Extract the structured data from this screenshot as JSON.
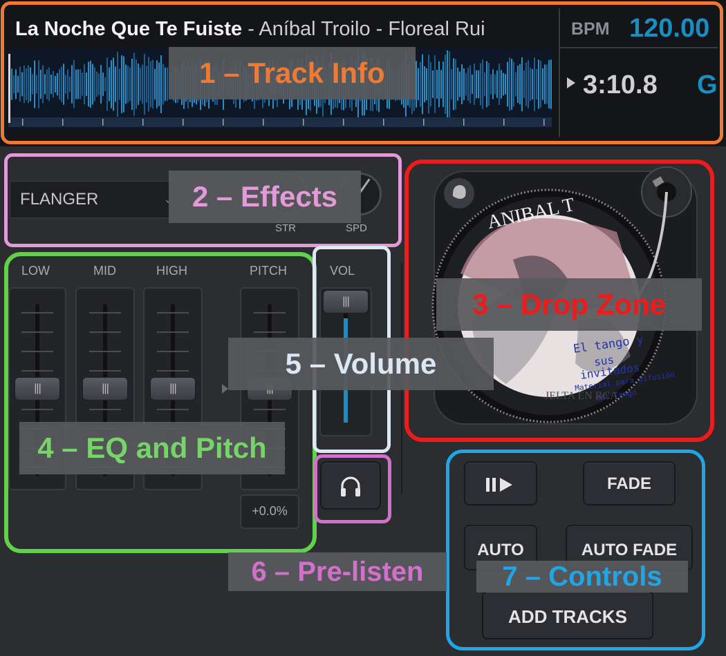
{
  "track": {
    "title": "La Noche Que Te Fuiste",
    "artists": " - Aníbal Troilo - Floreal Rui",
    "bpm_label": "BPM",
    "bpm_value": "120.00",
    "time": "3:10.8",
    "key": "G"
  },
  "effects": {
    "selected": "FLANGER",
    "knob_labels": [
      "STR",
      "SPD"
    ]
  },
  "eq": {
    "labels": [
      "LOW",
      "MID",
      "HIGH",
      "PITCH"
    ],
    "pitch_value": "+0.0%"
  },
  "volume": {
    "label": "VOL",
    "level": 0.88
  },
  "album_art": {
    "top_text": "ANIBAL T",
    "text_lines": [
      "El tango y",
      "sus",
      "invitados",
      "Material para difusión",
      "del Tango"
    ],
    "bottom_text": "JELTA EN RCA"
  },
  "controls": {
    "play_pause_icon": "play-pause-icon",
    "fade": "FADE",
    "auto": "AUTO",
    "auto_fade": "AUTO FADE",
    "add_tracks": "ADD TRACKS"
  },
  "prelisten": {
    "icon": "headphones-icon"
  },
  "annotations": [
    {
      "label": "1 – Track Info",
      "color": "#f07a34"
    },
    {
      "label": "2 – Effects",
      "color": "#e29ad8"
    },
    {
      "label": "3 – Drop Zone",
      "color": "#ef1b1b"
    },
    {
      "label": "4 – EQ and Pitch",
      "color": "#78d36b"
    },
    {
      "label": "5 – Volume",
      "color": "#dbe8f4"
    },
    {
      "label": "6 – Pre-listen",
      "color": "#d271cc"
    },
    {
      "label": "7 – Controls",
      "color": "#1fa6e6"
    }
  ]
}
